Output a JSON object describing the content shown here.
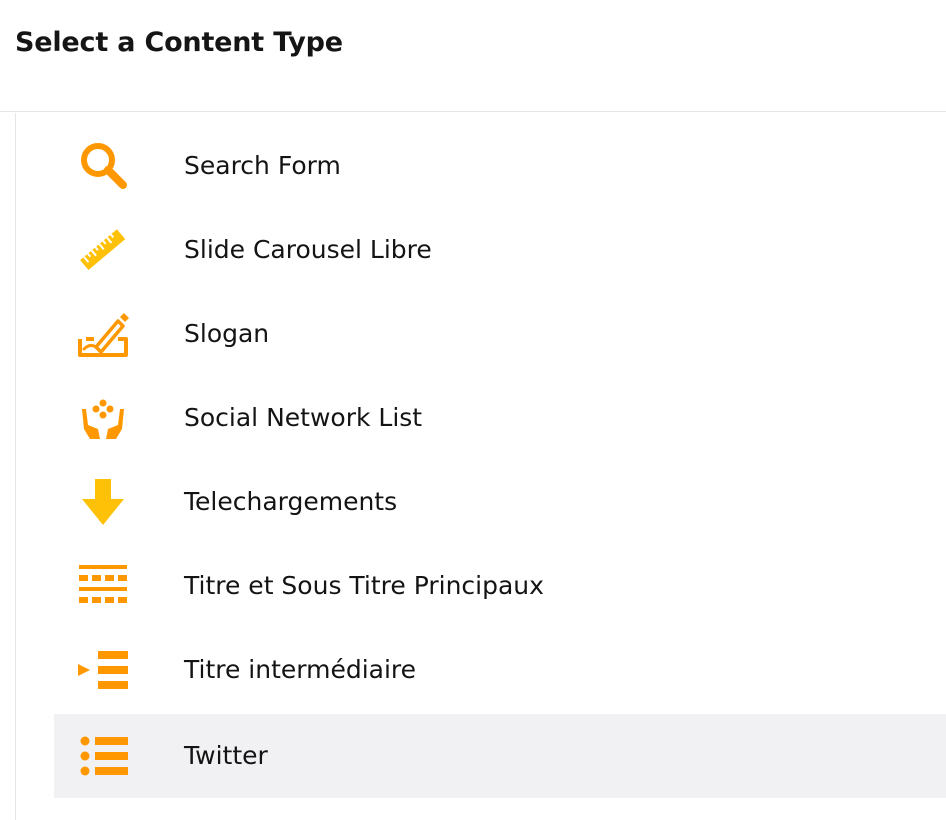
{
  "dialog": {
    "title": "Select a Content Type"
  },
  "colors": {
    "accent": "#ff9800",
    "accent_yellow": "#ffc107",
    "selected_bg": "#f1f1f3"
  },
  "content_types": [
    {
      "label": "Search Form",
      "icon": "search-icon"
    },
    {
      "label": "Slide Carousel Libre",
      "icon": "ruler-icon"
    },
    {
      "label": "Slogan",
      "icon": "pen-signature-icon"
    },
    {
      "label": "Social Network List",
      "icon": "hands-network-icon"
    },
    {
      "label": "Telechargements",
      "icon": "download-arrow-icon"
    },
    {
      "label": "Titre et Sous Titre Principaux",
      "icon": "title-blocks-icon"
    },
    {
      "label": "Titre intermédiaire",
      "icon": "subtitle-list-icon"
    },
    {
      "label": "Twitter",
      "icon": "bullet-list-icon",
      "selected": true
    }
  ]
}
